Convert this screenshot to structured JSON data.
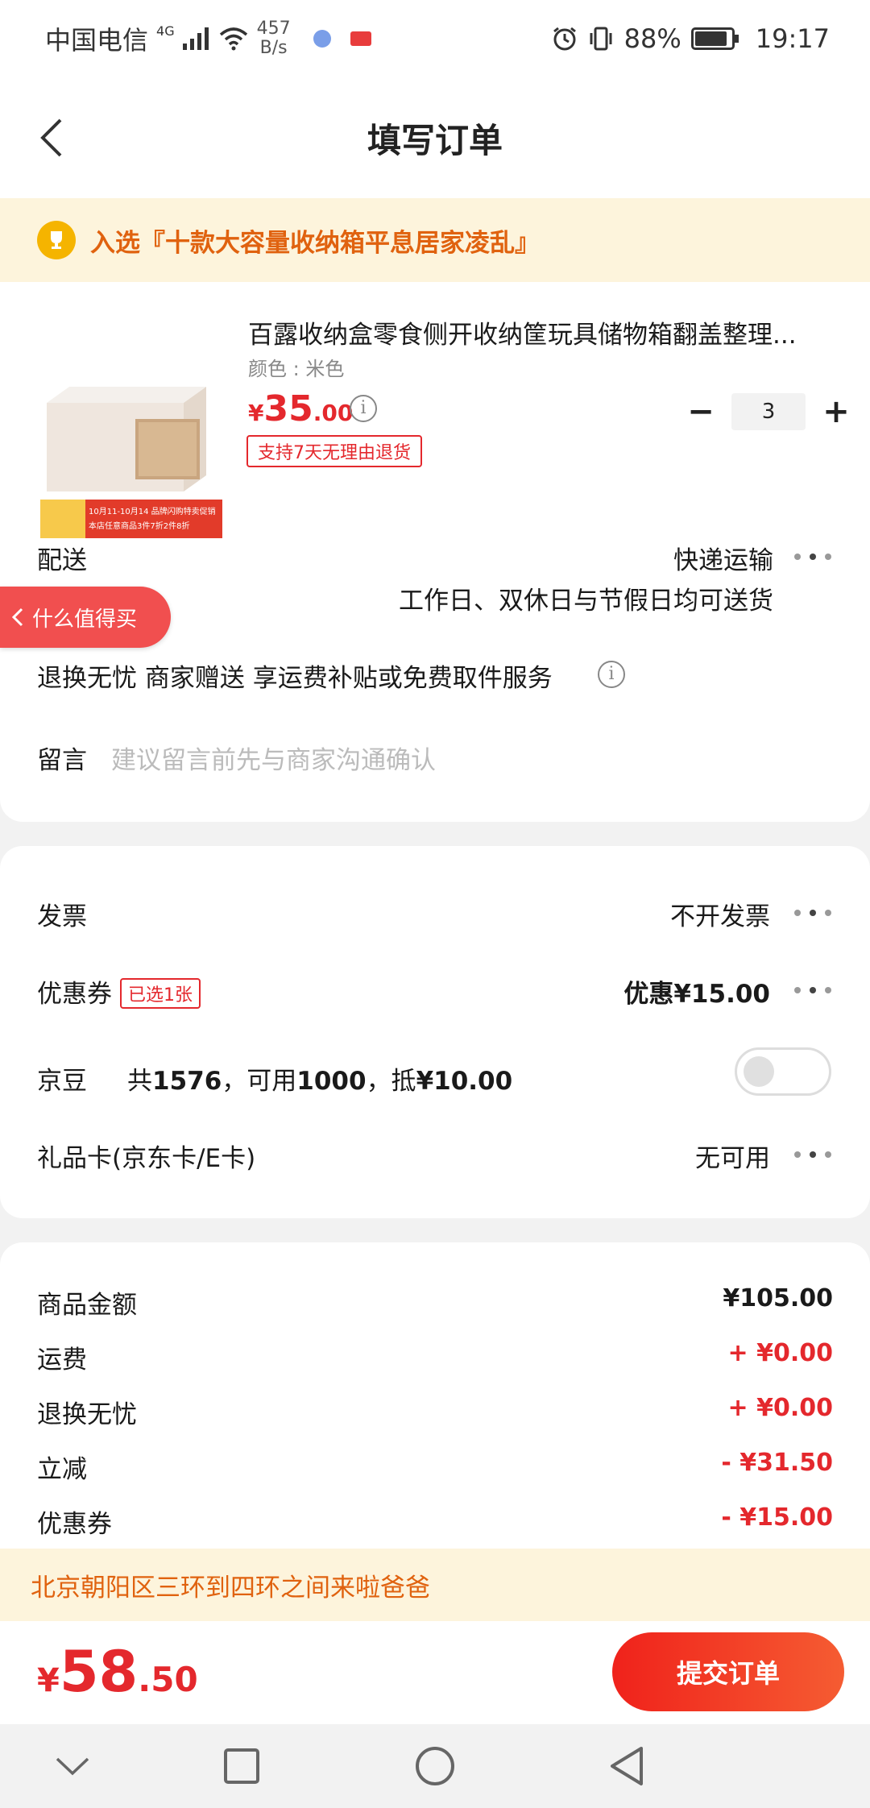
{
  "status_bar": {
    "carrier": "中国电信",
    "network": "4G",
    "net_speed_value": "457",
    "net_speed_unit": "B/s",
    "battery": "88%",
    "battery_level": 0.88,
    "time": "19:17"
  },
  "nav": {
    "title": "填写订单"
  },
  "banner": {
    "text": "入选『十款大容量收纳箱平息居家凌乱』",
    "icon": "trophy-icon"
  },
  "product": {
    "title": "百露收纳盒零食侧开收纳筐玩具储物箱翻盖整理...",
    "spec": "颜色 : 米色",
    "price_currency": "¥",
    "price_int": "35",
    "price_dec": ".00",
    "return_tag": "支持7天无理由退货",
    "quantity": "3",
    "image_promo_line1": "10月11-10月14 品牌闪购特卖促销",
    "image_promo_line2": "本店任意商品3件7折2件8折"
  },
  "delivery": {
    "label": "配送",
    "method": "快递运输",
    "note": "工作日、双休日与节假日均可送货"
  },
  "float_button": {
    "label": "什么值得买"
  },
  "return_service": {
    "text": "退换无忧 商家赠送  享运费补贴或免费取件服务"
  },
  "message": {
    "label": "留言",
    "placeholder": "建议留言前先与商家沟通确认"
  },
  "invoice": {
    "label": "发票",
    "value": "不开发票"
  },
  "coupon": {
    "label": "优惠券",
    "tag": "已选1张",
    "value": "优惠¥15.00"
  },
  "jingdou": {
    "label": "京豆",
    "desc_prefix": "共",
    "total": "1576",
    "desc_mid": "，可用",
    "usable": "1000",
    "desc_mid2": "，抵",
    "deduct": "¥10.00",
    "enabled": false
  },
  "gift_card": {
    "label": "礼品卡(京东卡/E卡)",
    "value": "无可用"
  },
  "summary": [
    {
      "label": "商品金额",
      "value": "¥105.00",
      "color": "#1a1a1a"
    },
    {
      "label": "运费",
      "value": "+ ¥0.00",
      "color": "#e4282d"
    },
    {
      "label": "退换无忧",
      "value": "+ ¥0.00",
      "color": "#e4282d"
    },
    {
      "label": "立减",
      "value": "- ¥31.50",
      "color": "#e4282d"
    },
    {
      "label": "优惠券",
      "value": "- ¥15.00",
      "color": "#e4282d"
    }
  ],
  "address": {
    "text": "北京朝阳区三环到四环之间来啦爸爸"
  },
  "footer": {
    "total_currency": "¥",
    "total_int": "58",
    "total_dec": ".50",
    "submit_label": "提交订单"
  },
  "colors": {
    "accent_red": "#e4282d",
    "banner_orange": "#e0620f",
    "banner_bg": "#fdf4dc"
  }
}
